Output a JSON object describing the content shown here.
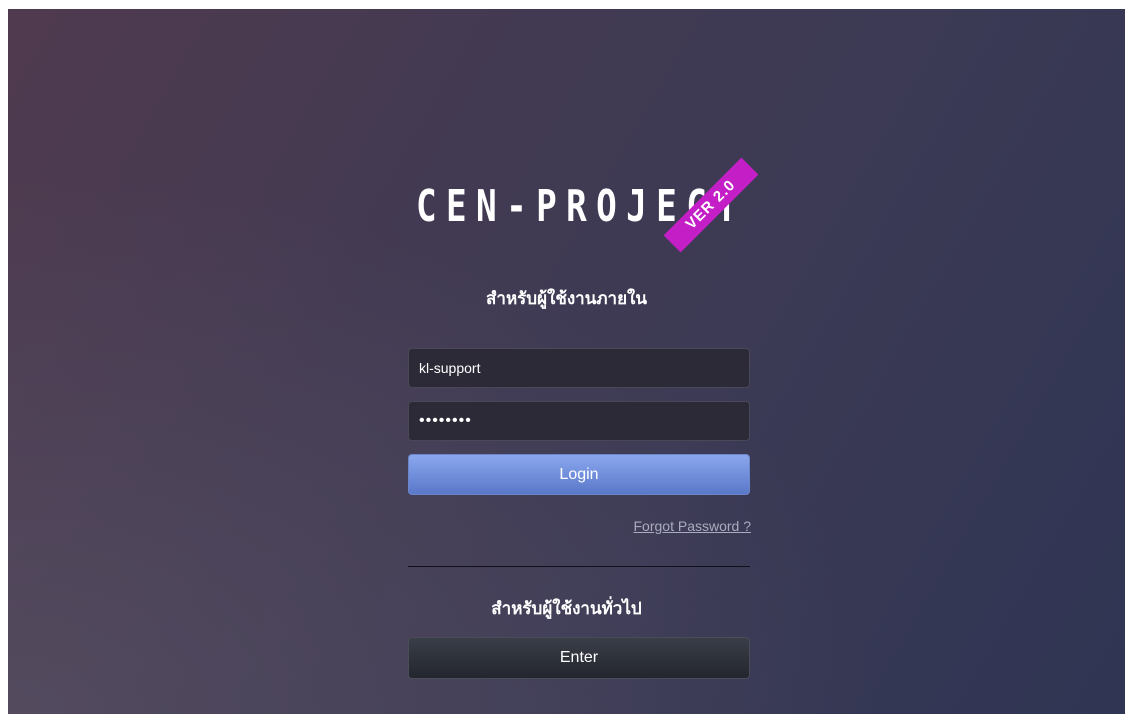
{
  "logo": {
    "text": "CEN-PROJECT",
    "version_ribbon": "VER 2.0",
    "ribbon_color": "#c41ec7"
  },
  "internal_section": {
    "title": "สำหรับผู้ใช้งานภายใน",
    "username_value": "kl-support",
    "password_value": "••••••••",
    "login_label": "Login",
    "forgot_password_label": "Forgot Password ?"
  },
  "general_section": {
    "title": "สำหรับผู้ใช้งานทั่วไป",
    "enter_label": "Enter"
  },
  "colors": {
    "login_button": "#7090dc",
    "enter_button": "#2e313a",
    "input_background": "#2b2a36"
  }
}
